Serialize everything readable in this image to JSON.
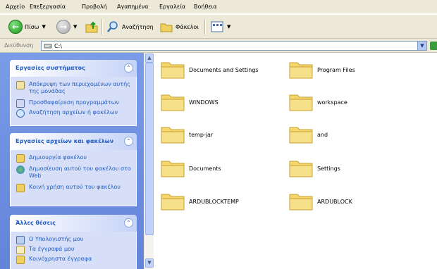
{
  "menu": [
    "Αρχείο",
    "Επεξεργασία",
    "Προβολή",
    "Αγαπημένα",
    "Εργαλεία",
    "Βοήθεια"
  ],
  "toolbar": {
    "back_label": "Πίσω",
    "search_label": "Αναζήτηση",
    "folders_label": "Φάκελοι"
  },
  "address": {
    "label": "Διεύθυνση",
    "value": "C:\\"
  },
  "sidebar": {
    "system_tasks": {
      "title": "Εργασίες συστήματος",
      "items": [
        "Απόκρυψη των περιεχομένων αυτής της μονάδας",
        "Προσθαφαίρεση προγραμμάτων",
        "Αναζήτηση αρχείων ή φακέλων"
      ]
    },
    "file_tasks": {
      "title": "Εργασίες αρχείων και φακέλων",
      "items": [
        "Δημιουργία φακέλου",
        "Δημοσίευση αυτού του φακέλου στο Web",
        "Κοινή χρήση αυτού του φακέλου"
      ]
    },
    "other_places": {
      "title": "Άλλες θέσεις",
      "items": [
        "Ο Υπολογιστής μου",
        "Τα έγγραφά μου",
        "Κοινόχρηστα έγγραφα"
      ]
    }
  },
  "folders": [
    "Documents and Settings",
    "Program Files",
    "WINDOWS",
    "workspace",
    "temp-jar",
    "and",
    "Documents",
    "Settings",
    "ARDUBLOCKTEMP",
    "ARDUBLOCK"
  ],
  "colors": {
    "taskpane": "#6383d9",
    "panel_title": "#215dc6",
    "chrome": "#ece9d8"
  }
}
